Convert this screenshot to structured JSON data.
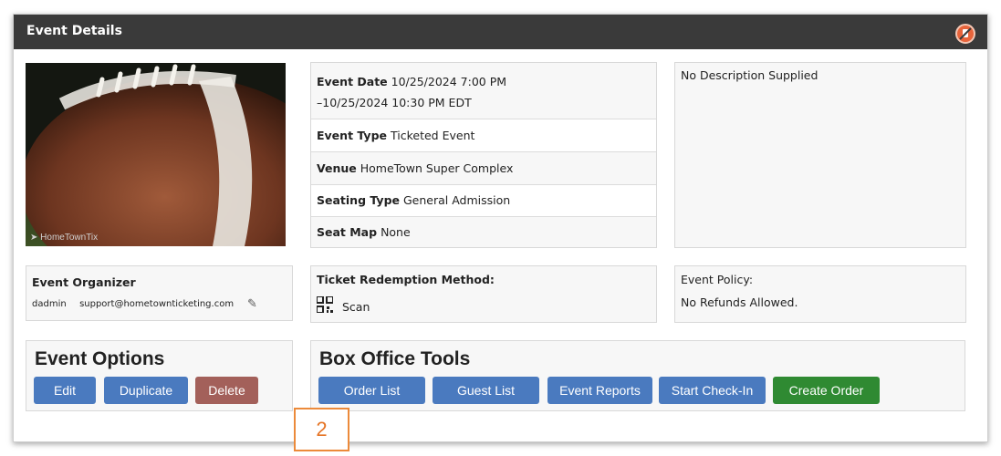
{
  "panel": {
    "title": "Event Details",
    "header_icon": "disabled-ban-icon"
  },
  "image": {
    "caption": "HomeTownTix",
    "caption_icon": "twitter-bird-icon"
  },
  "details": {
    "event_date_label": "Event Date",
    "event_date_value_line1": "10/25/2024 7:00 PM",
    "event_date_value_line2": "–10/25/2024 10:30 PM EDT",
    "event_type_label": "Event Type",
    "event_type_value": "Ticketed Event",
    "venue_label": "Venue",
    "venue_value": "HomeTown Super Complex",
    "seating_type_label": "Seating Type",
    "seating_type_value": "General Admission",
    "seat_map_label": "Seat Map",
    "seat_map_value": "None"
  },
  "description": {
    "text": "No Description Supplied"
  },
  "organizer": {
    "heading": "Event Organizer",
    "username": "dadmin",
    "email": "support@hometownticketing.com",
    "edit_icon": "pencil-icon"
  },
  "redemption": {
    "heading": "Ticket Redemption Method:",
    "method": "Scan",
    "method_icon": "qr-code-icon"
  },
  "policy": {
    "heading": "Event Policy:",
    "text": "No Refunds Allowed."
  },
  "event_options": {
    "heading": "Event Options",
    "edit_label": "Edit",
    "duplicate_label": "Duplicate",
    "delete_label": "Delete"
  },
  "box_office": {
    "heading": "Box Office Tools",
    "order_list_label": "Order List",
    "guest_list_label": "Guest List",
    "event_reports_label": "Event Reports",
    "start_checkin_label": "Start Check-In",
    "create_order_label": "Create Order"
  },
  "callout": {
    "number": "2"
  },
  "colors": {
    "header_bg": "#3a3a3a",
    "button_blue": "#4a7abf",
    "button_delete": "#a3605a",
    "button_green": "#2f8a32",
    "callout_orange": "#ec8a3a"
  }
}
